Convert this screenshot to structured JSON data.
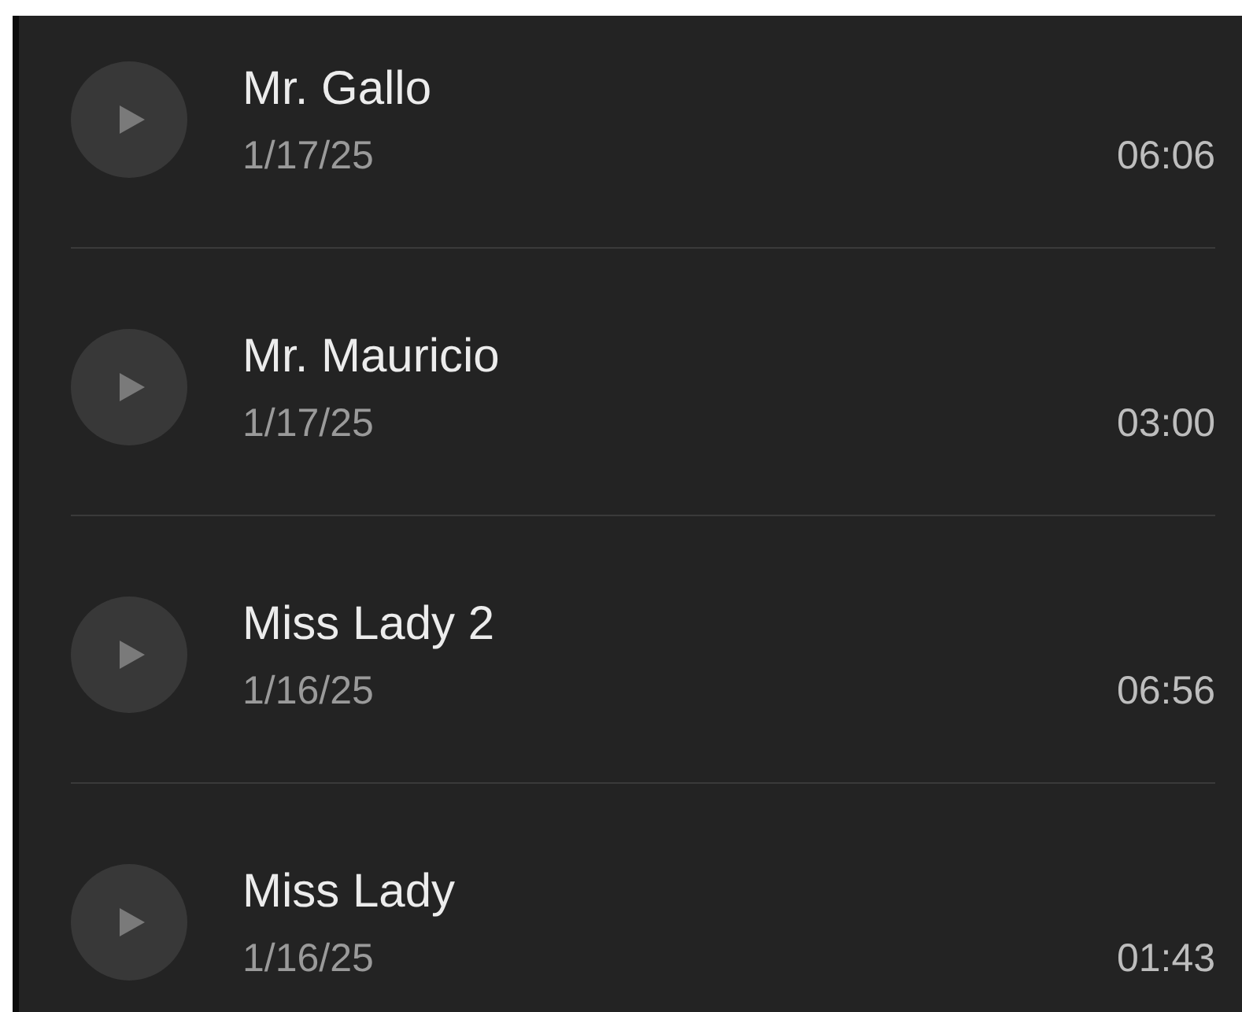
{
  "recordings": [
    {
      "name": "Mr. Gallo",
      "date": "1/17/25",
      "duration": "06:06"
    },
    {
      "name": "Mr. Mauricio",
      "date": "1/17/25",
      "duration": "03:00"
    },
    {
      "name": "Miss Lady 2",
      "date": "1/16/25",
      "duration": "06:56"
    },
    {
      "name": "Miss Lady",
      "date": "1/16/25",
      "duration": "01:43"
    }
  ]
}
